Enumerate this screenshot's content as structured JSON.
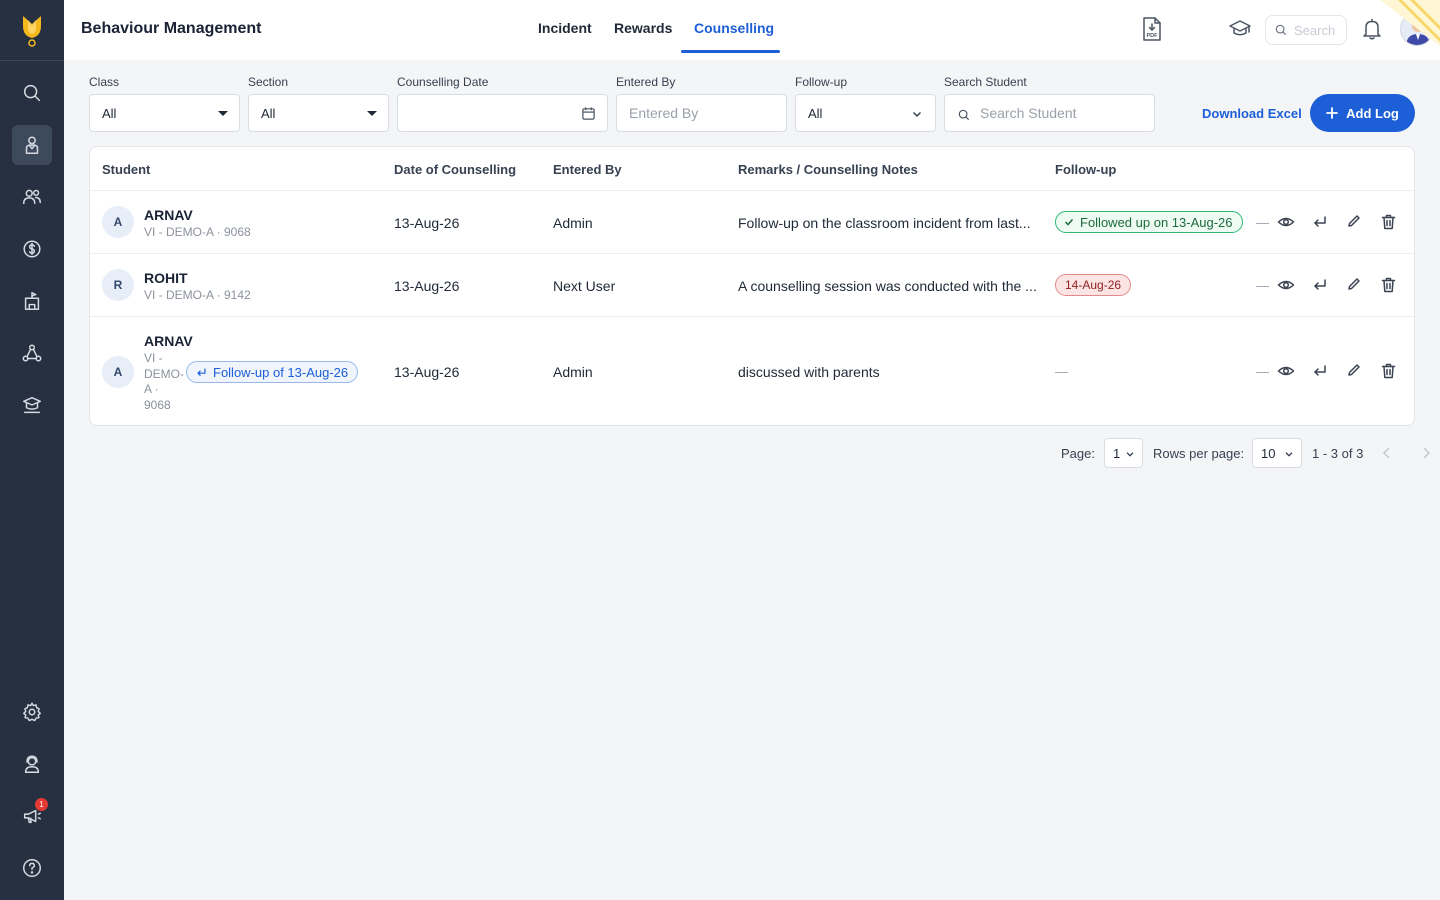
{
  "app": {
    "title": "Behaviour Management"
  },
  "tabs": [
    {
      "label": "Incident"
    },
    {
      "label": "Rewards"
    },
    {
      "label": "Counselling",
      "active": true
    }
  ],
  "header": {
    "search_placeholder": "Search",
    "pdf_label": "PDF"
  },
  "sidebar": {
    "notification_count": "1"
  },
  "filters": {
    "class": {
      "label": "Class",
      "value": "All"
    },
    "section": {
      "label": "Section",
      "value": "All"
    },
    "counselling_date": {
      "label": "Counselling Date",
      "value": ""
    },
    "entered_by": {
      "label": "Entered By",
      "placeholder": "Entered By"
    },
    "follow_up": {
      "label": "Follow-up",
      "value": "All"
    },
    "search_student": {
      "label": "Search Student",
      "placeholder": "Search Student"
    }
  },
  "actions": {
    "download_excel": "Download Excel",
    "add_log": "Add Log"
  },
  "table": {
    "columns": [
      "Student",
      "Date of Counselling",
      "Entered By",
      "Remarks / Counselling Notes",
      "Follow-up"
    ],
    "rows": [
      {
        "initial": "A",
        "name": "ARNAV",
        "meta": "VI - DEMO-A · 9068",
        "date": "13-Aug-26",
        "entered_by": "Admin",
        "remarks": "Follow-up on the classroom incident from last...",
        "follow_up": "Followed up on 13-Aug-26",
        "follow_up_status": "done",
        "dash": "—"
      },
      {
        "initial": "R",
        "name": "ROHIT",
        "meta": "VI - DEMO-A · 9142",
        "date": "13-Aug-26",
        "entered_by": "Next User",
        "remarks": "A counselling session was conducted with the ...",
        "follow_up": "14-Aug-26",
        "follow_up_status": "due",
        "dash": "—"
      },
      {
        "initial": "A",
        "name": "ARNAV",
        "meta_lines": [
          "VI -",
          "DEMO-",
          "A ·",
          "9068"
        ],
        "linked_chip": "Follow-up of 13-Aug-26",
        "date": "13-Aug-26",
        "entered_by": "Admin",
        "remarks": "discussed with parents",
        "follow_up": "—",
        "follow_up_status": "none",
        "dash": "—"
      }
    ]
  },
  "pagination": {
    "page_label": "Page:",
    "page_value": "1",
    "rows_label": "Rows per page:",
    "rows_value": "10",
    "range": "1 - 3 of 3"
  },
  "colors": {
    "accent": "#1d5fd6",
    "sidebar": "#263040",
    "success": "#2eb872",
    "danger": "#e28a8a"
  }
}
